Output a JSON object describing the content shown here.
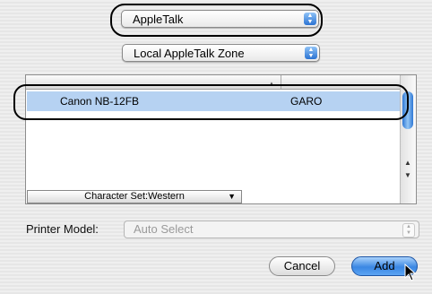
{
  "protocol_popup": {
    "value": "AppleTalk"
  },
  "zone_popup": {
    "value": "Local AppleTalk Zone"
  },
  "printer_list": {
    "selected_row": {
      "name": "Canon NB-12FB",
      "type": "GARO"
    },
    "character_set": "Character Set:Western"
  },
  "printer_model": {
    "label": "Printer Model:",
    "value": "Auto Select"
  },
  "buttons": {
    "cancel": "Cancel",
    "add": "Add"
  },
  "icons": {
    "popup": "up-down-arrows-icon",
    "cursor": "arrow-pointer-icon"
  },
  "colors": {
    "selection": "#b6d2f2",
    "accent": "#3b87e3"
  }
}
